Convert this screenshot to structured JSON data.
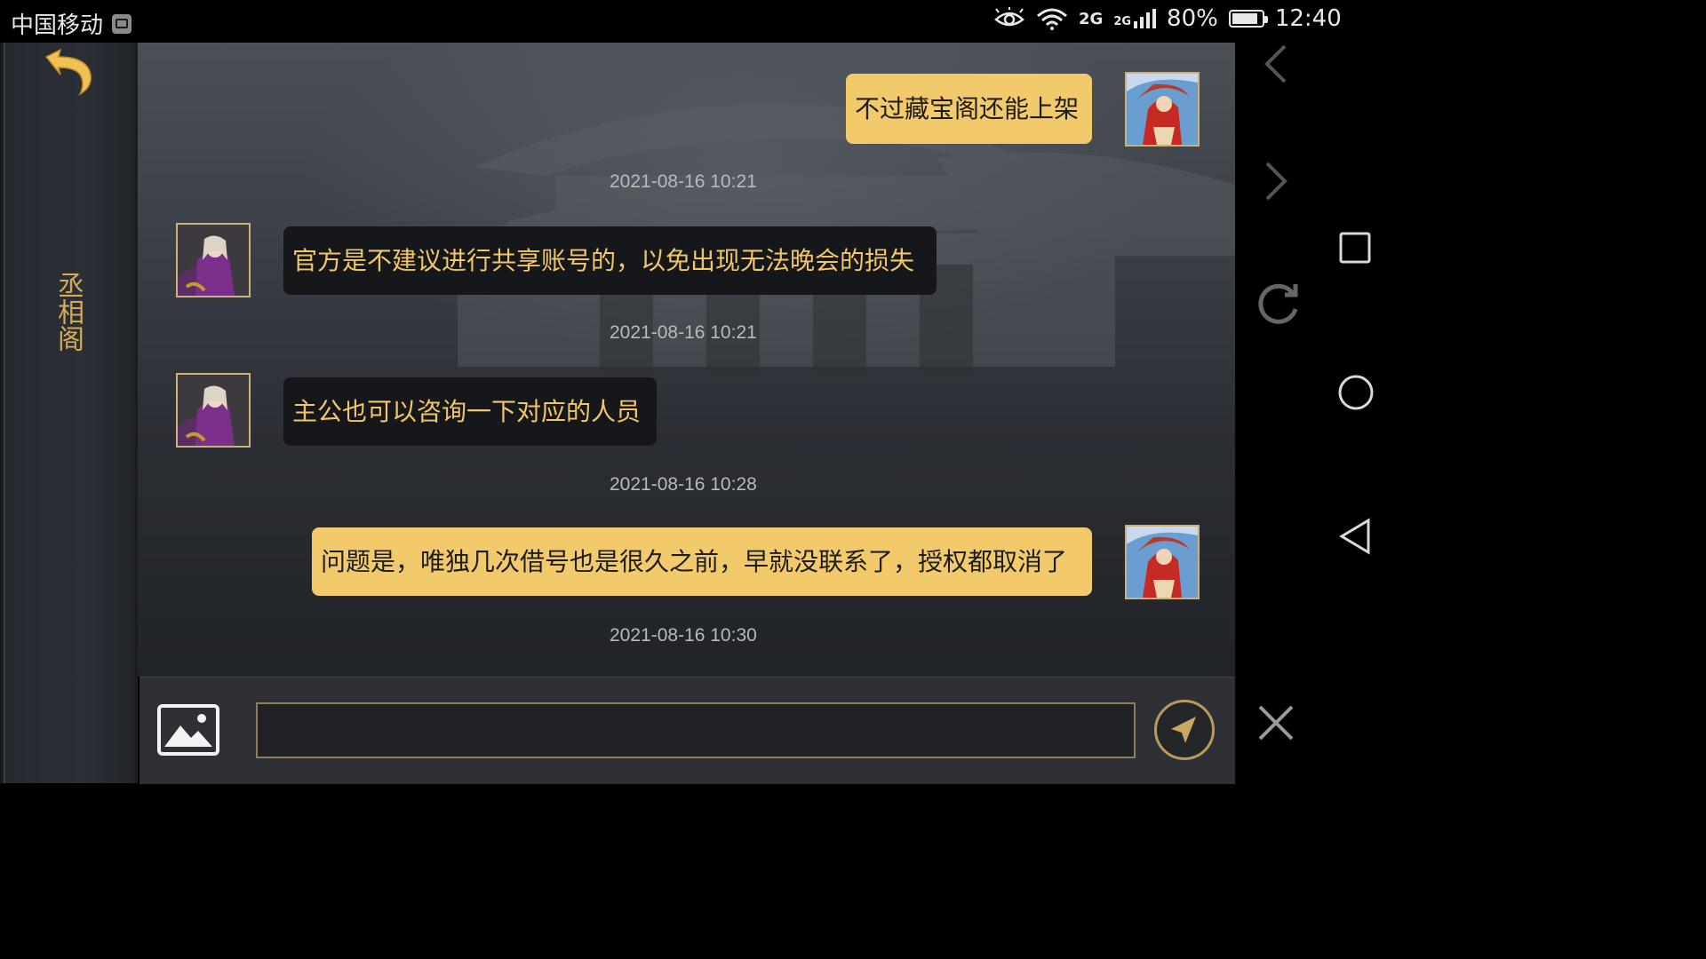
{
  "status_bar": {
    "carrier": "中国移动",
    "network_1": "2G",
    "network_2": "2G",
    "battery_percent": "80%",
    "time": "12:40",
    "icons": [
      "image-notification-icon",
      "eye-comfort-icon",
      "wifi-icon",
      "signal-icon",
      "battery-icon"
    ]
  },
  "sidebar": {
    "title": "丞相阁",
    "back_icon": "back-arrow-icon"
  },
  "messages": [
    {
      "sender": "self",
      "text": "不过藏宝阁还能上架",
      "timestamp": "2021-08-16 10:21"
    },
    {
      "sender": "other",
      "text": "官方是不建议进行共享账号的，以免出现无法晚会的损失",
      "timestamp": "2021-08-16 10:21"
    },
    {
      "sender": "other",
      "text": "主公也可以咨询一下对应的人员",
      "timestamp": "2021-08-16 10:28"
    },
    {
      "sender": "self",
      "text": "问题是，唯独几次借号也是很久之前，早就没联系了，授权都取消了",
      "timestamp": "2021-08-16 10:30"
    }
  ],
  "input_bar": {
    "value": "",
    "image_button_icon": "image-picture-icon",
    "send_button_icon": "send-arrow-icon"
  },
  "nav_bar": {
    "icons": [
      "chevron-left-icon",
      "chevron-right-icon",
      "recents-square-icon",
      "rotate-icon",
      "home-circle-icon",
      "back-triangle-icon",
      "close-x-icon"
    ]
  },
  "colors": {
    "self_bubble": "#f2c96b",
    "other_bubble": "#16171a",
    "other_text": "#f0c668",
    "sidebar_title": "#d6aa55",
    "timestamp": "#b7b9bd"
  }
}
